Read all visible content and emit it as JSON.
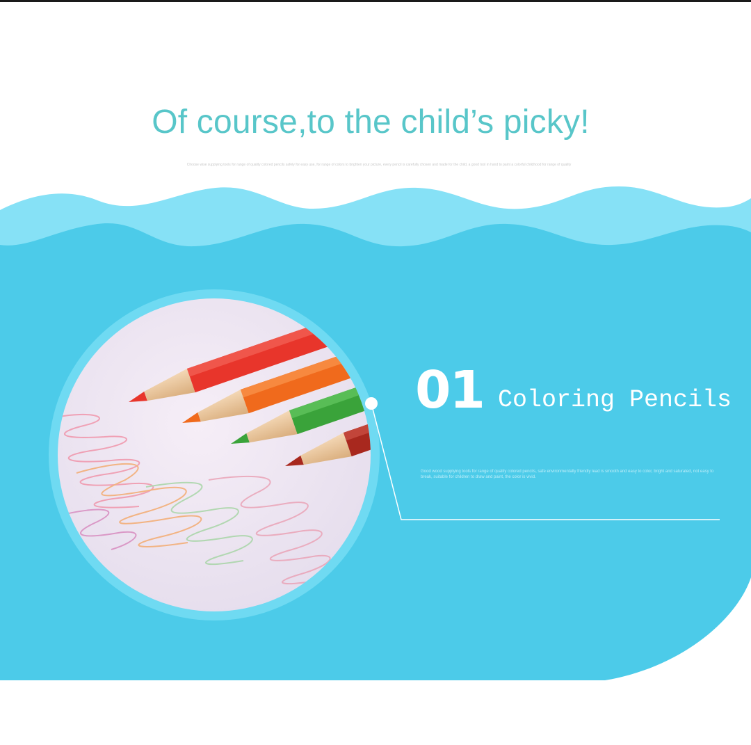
{
  "headline": "Of course,to the child’s picky!",
  "fineprint": "Choose wise supplying tools for range of quality colored pencils safely for easy use, for range of colors to brighten your picture, every pencil is carefully chosen and made for the child, a good tool in hand to paint a colorful childhood for range of quality",
  "feature": {
    "number": "01",
    "title": "Coloring Pencils",
    "description": "Good wood supplying tools for range of quality colored pencils, safe environmentally friendly lead is smooth and easy to color, bright and saturated, not easy to break, suitable for children to draw and paint, the color is vivid."
  },
  "colors": {
    "headline": "#58c6c9",
    "wave_light": "#86e1f6",
    "panel": "#4ccbe9",
    "pencil_red": "#e8352b",
    "pencil_orange": "#f06a1c",
    "pencil_green": "#3aa33a",
    "pencil_brown": "#a8281e"
  },
  "icons": [
    "pencil-red-icon",
    "pencil-orange-icon",
    "pencil-green-icon",
    "pencil-brown-icon",
    "connector-dot-icon"
  ]
}
